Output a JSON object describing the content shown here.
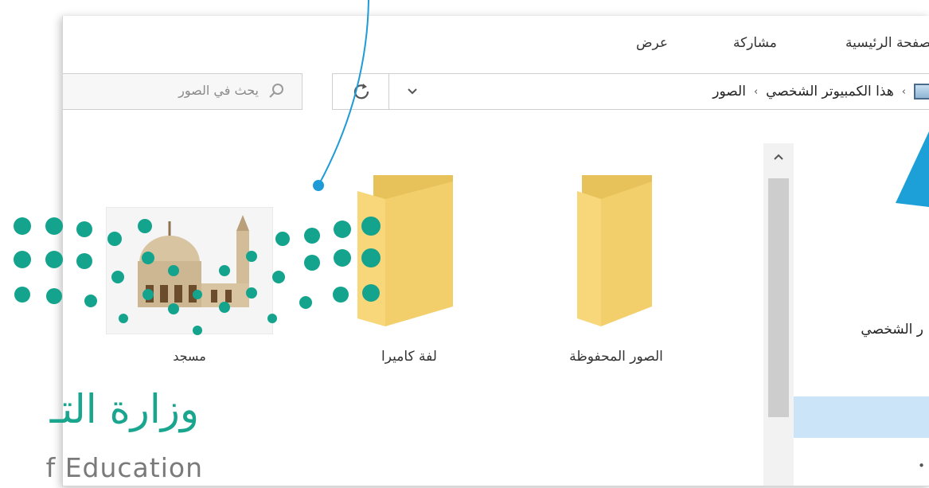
{
  "ribbon": {
    "tabs": [
      {
        "label": "الصفحة الرئيسية"
      },
      {
        "label": "مشاركة"
      },
      {
        "label": "عرض"
      }
    ]
  },
  "address_bar": {
    "path": [
      {
        "label": "هذا الكمبيوتر الشخصي"
      },
      {
        "label": "الصور"
      }
    ],
    "separator": "›"
  },
  "search": {
    "placeholder": "يحث في الصور"
  },
  "items": [
    {
      "name": "الصور المحفوظة",
      "icon": "folder-icon"
    },
    {
      "name": "لفة كاميرا",
      "icon": "folder-icon"
    },
    {
      "name": "مسجد",
      "icon": "mosque-thumbnail"
    }
  ],
  "nav_pane": {
    "label": "ر الشخصي"
  },
  "logo": {
    "arabic": "وزارة التـ",
    "english": "f Education"
  },
  "colors": {
    "folder": "#f7d77a",
    "selection": "#cce4f7",
    "logo_green": "#1aa58f",
    "callout_blue": "#1e9bd7"
  }
}
